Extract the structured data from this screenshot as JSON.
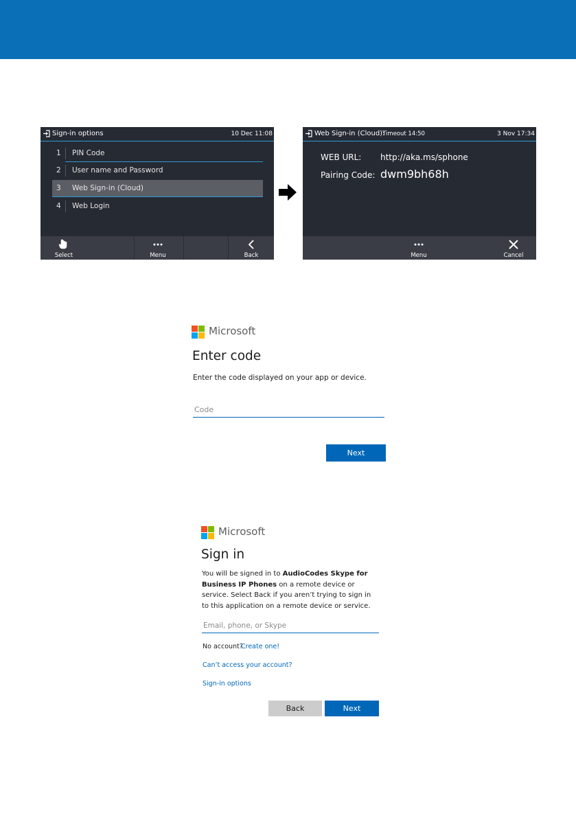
{
  "colors": {
    "header_band": "#0a6fb6",
    "accent_blue": "#0067b8",
    "phone_bg": "#262a33",
    "highlight": "#2f9ad6"
  },
  "phone1": {
    "title": "Sign-in options",
    "clock": "10 Dec 11:08",
    "items": [
      {
        "num": "1",
        "label": "PIN Code"
      },
      {
        "num": "2",
        "label": "User name and Password"
      },
      {
        "num": "3",
        "label": "Web Sign-in (Cloud)",
        "selected": true
      },
      {
        "num": "4",
        "label": "Web Login"
      }
    ],
    "softkeys": {
      "select": "Select",
      "menu": "Menu",
      "back": "Back"
    },
    "icons": [
      "signin-icon",
      "hand-pointer-icon",
      "ellipsis-icon",
      "chevron-left-icon"
    ]
  },
  "phone2": {
    "title": "Web Sign-in (Cloud):",
    "timeout": "Timeout 14:50",
    "clock": "3 Nov 17:34",
    "web_url_label": "WEB URL:",
    "web_url_value": "http://aka.ms/sphone",
    "pairing_label": "Pairing Code:",
    "pairing_value": "dwm9bh68h",
    "softkeys": {
      "menu": "Menu",
      "cancel": "Cancel"
    },
    "icons": [
      "signin-icon",
      "ellipsis-icon",
      "close-icon"
    ]
  },
  "enter_code": {
    "brand": "Microsoft",
    "heading": "Enter code",
    "subtext": "Enter the code displayed on your app or device.",
    "code_placeholder": "Code",
    "next_label": "Next"
  },
  "sign_in": {
    "brand": "Microsoft",
    "heading": "Sign in",
    "desc_1": "You will be signed in to ",
    "desc_bold": "AudioCodes Skype for Business IP Phones",
    "desc_2": " on a remote device or service. Select Back if you aren’t trying to sign in to this application on a remote device or service.",
    "email_placeholder": "Email, phone, or Skype",
    "no_account": "No account?",
    "create_one": "Create one!",
    "cant_access": "Can’t access your account?",
    "signin_options": "Sign-in options",
    "back_label": "Back",
    "next_label": "Next"
  }
}
